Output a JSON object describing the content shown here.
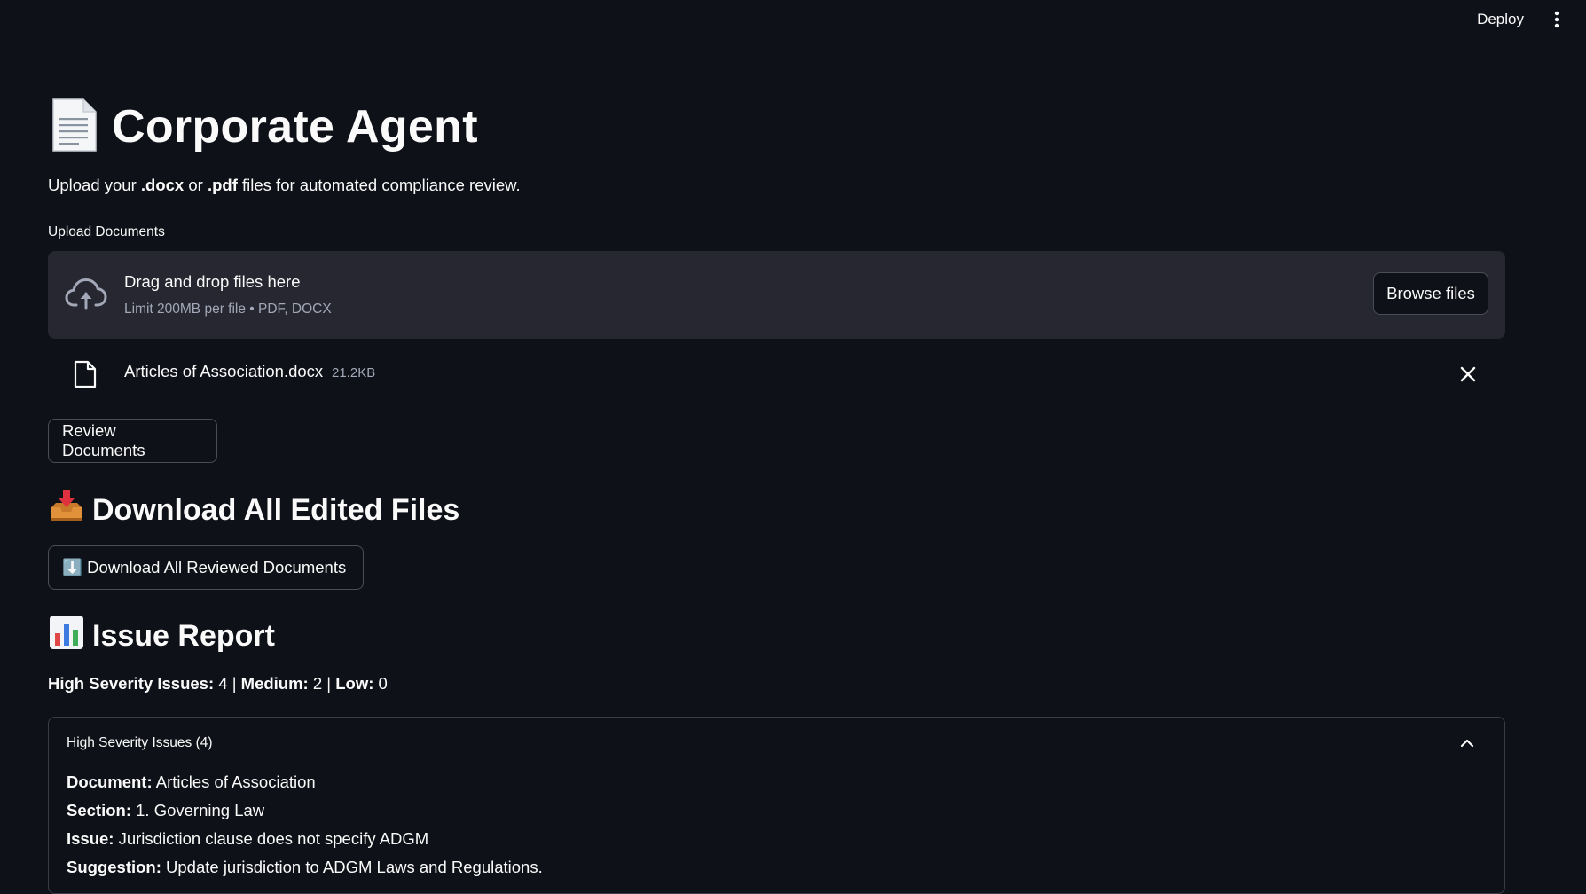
{
  "header": {
    "deploy_label": "Deploy",
    "menu_icon": "kebab-menu-icon"
  },
  "page": {
    "title_icon": "page-document-emoji",
    "title": "Corporate Agent",
    "subtitle": {
      "prefix": "Upload your ",
      "ext1": ".docx",
      "middle": " or ",
      "ext2": ".pdf",
      "suffix": " files for automated compliance review."
    }
  },
  "uploader": {
    "label": "Upload Documents",
    "drop_text": "Drag and drop files here",
    "limit_text": "Limit 200MB per file • PDF, DOCX",
    "browse_label": "Browse files",
    "icon": "cloud-upload-icon",
    "files": [
      {
        "name": "Articles of Association.docx",
        "size": "21.2KB",
        "icon": "file-icon"
      }
    ]
  },
  "actions": {
    "review_label": "Review Documents"
  },
  "download_section": {
    "icon": "inbox-tray-emoji",
    "heading": "Download All Edited Files",
    "button_label": "⬇️ Download All Reviewed Documents"
  },
  "report": {
    "icon": "bar-chart-emoji",
    "heading": "Issue Report",
    "summary": {
      "high_label": "High Severity Issues:",
      "high_value": " 4 | ",
      "medium_label": "Medium:",
      "medium_value": " 2 | ",
      "low_label": "Low:",
      "low_value": " 0"
    },
    "expander": {
      "title": "High Severity Issues (4)",
      "expanded": true,
      "issue": {
        "document_label": "Document:",
        "document_value": " Articles of Association",
        "section_label": "Section:",
        "section_value": " 1. Governing Law",
        "issue_label": "Issue:",
        "issue_value": " Jurisdiction clause does not specify ADGM",
        "suggestion_label": "Suggestion:",
        "suggestion_value": " Update jurisdiction to ADGM Laws and Regulations."
      }
    }
  },
  "colors": {
    "background": "#0e1117",
    "surface": "#262730",
    "text": "#fafafa",
    "muted": "#a3a8b8",
    "border": "#4a4d58"
  }
}
